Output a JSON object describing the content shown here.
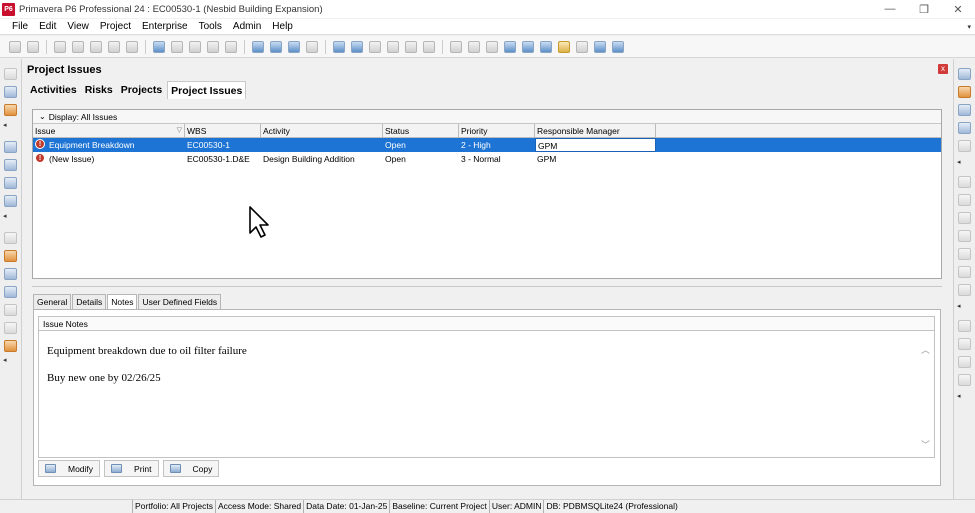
{
  "window": {
    "logo": "P6",
    "title": "Primavera P6 Professional 24 : EC00530-1 (Nesbid Building Expansion)",
    "controls": [
      "—",
      "❐",
      "✕"
    ]
  },
  "menu": {
    "items": [
      "File",
      "Edit",
      "View",
      "Project",
      "Enterprise",
      "Tools",
      "Admin",
      "Help"
    ],
    "overflow": "▾"
  },
  "page": {
    "title": "Project Issues",
    "close": "x"
  },
  "tabs": [
    "Activities",
    "Risks",
    "Projects",
    "Project Issues"
  ],
  "display": {
    "chevron": "⌄",
    "label": "Display: All Issues"
  },
  "grid": {
    "columns": [
      "Issue",
      "WBS",
      "Activity",
      "Status",
      "Priority",
      "Responsible Manager"
    ],
    "rows": [
      {
        "issue": "Equipment Breakdown",
        "wbs": "EC00530-1",
        "activity": "",
        "status": "Open",
        "priority": "2 - High",
        "manager": "GPM"
      },
      {
        "issue": "(New Issue)",
        "wbs": "EC00530-1.D&E",
        "activity": "Design Building Addition",
        "status": "Open",
        "priority": "3 - Normal",
        "manager": "GPM"
      }
    ],
    "issue_icon": "!",
    "filter_icon": "▽"
  },
  "detail_tabs": [
    "General",
    "Details",
    "Notes",
    "User Defined Fields"
  ],
  "notes": {
    "label": "Issue Notes",
    "lines": [
      "Equipment breakdown due to oil filter failure",
      "Buy new one by 02/26/25"
    ],
    "scroll_up": "︿",
    "scroll_down": "﹀"
  },
  "buttons": {
    "modify": "Modify",
    "print": "Print",
    "copy": "Copy"
  },
  "statusbar": {
    "portfolio": "Portfolio: All Projects",
    "access": "Access Mode: Shared",
    "data_date": "Data Date: 01-Jan-25",
    "baseline": "Baseline: Current Project",
    "user": "User: ADMIN",
    "db": "DB: PDBMSQLite24 (Professional)"
  },
  "colors": {
    "selection": "#1e74d4",
    "issue_icon": "#c0392b",
    "logo": "#c8102e"
  }
}
